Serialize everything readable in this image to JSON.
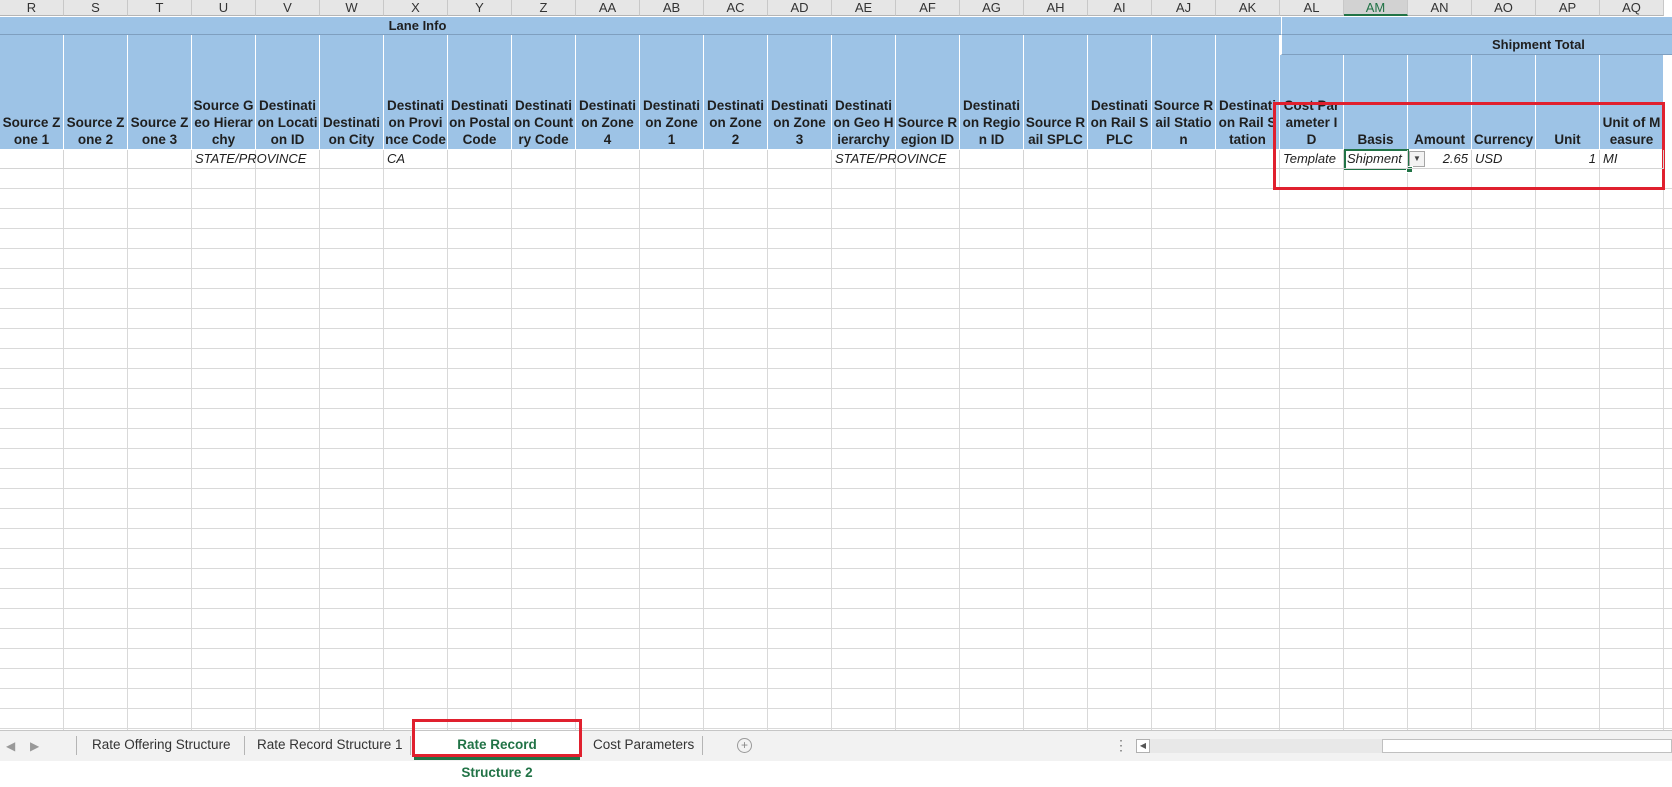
{
  "columns": [
    "R",
    "S",
    "T",
    "U",
    "V",
    "W",
    "X",
    "Y",
    "Z",
    "AA",
    "AB",
    "AC",
    "AD",
    "AE",
    "AF",
    "AG",
    "AH",
    "AI",
    "AJ",
    "AK",
    "AL",
    "AM",
    "AN",
    "AO",
    "AP",
    "AQ"
  ],
  "selected_column": "AM",
  "bands": {
    "lane_info": "Lane Info",
    "shipment_total": "Shipment Total"
  },
  "headers": {
    "R": "Source Zone 1",
    "S": "Source Zone 2",
    "T": "Source Zone 3",
    "U": "Source Geo Hierarchy",
    "V": "Destination Location ID",
    "W": "Destination City",
    "X": "Destination Province Code",
    "Y": "Destination Postal Code",
    "Z": "Destination Country Code",
    "AA": "Destination Zone 4",
    "AB": "Destination Zone 1",
    "AC": "Destination Zone 2",
    "AD": "Destination Zone 3",
    "AE": "Destination Geo Hierarchy",
    "AF": "Source Region ID",
    "AG": "Destination Region ID",
    "AH": "Source Rail SPLC",
    "AI": "Destination Rail SPLC",
    "AJ": "Source Rail Station",
    "AK": "Destination Rail Station",
    "AL": "Cost Parameter ID",
    "AM": "Basis",
    "AN": "Amount",
    "AO": "Currency",
    "AP": "Unit",
    "AQ": "Unit of Measure"
  },
  "row": {
    "U": "STATE/PROVINCE",
    "X": "CA",
    "AE": "STATE/PROVINCE",
    "AL": "Template",
    "AM": "Shipment",
    "AN": "2.65",
    "AO": "USD",
    "AP": "1",
    "AQ": "MI"
  },
  "tabs": [
    "Rate Offering Structure",
    "Rate Record Structure 1",
    "Rate Record Structure 2",
    "Cost Parameters"
  ],
  "active_tab": "Rate Record Structure 2",
  "icons": {
    "dropdown": "dropdown-arrow-icon",
    "add_sheet": "add-sheet-icon",
    "scroll_left": "scroll-left-icon"
  }
}
